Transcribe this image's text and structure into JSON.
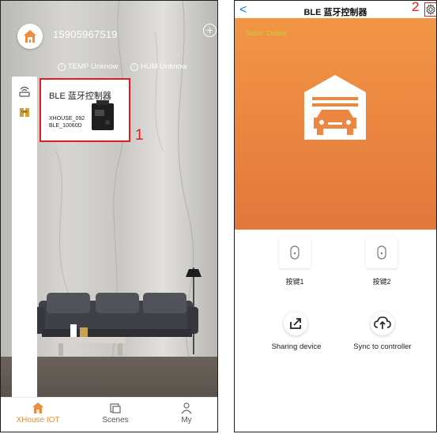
{
  "home": {
    "phone": "15905967519",
    "temp_label": "TEMP Unknow",
    "hum_label": "HUM Unknow",
    "device": {
      "name": "BLE 蓝牙控制器",
      "id_line1": "XHOUSE_092",
      "id_line2": "BLE_10060D"
    },
    "marker": "1",
    "tabs": [
      {
        "label": "XHouse IOT",
        "icon": "home-icon",
        "active": true
      },
      {
        "label": "Scenes",
        "icon": "scenes-icon",
        "active": false
      },
      {
        "label": "My",
        "icon": "user-icon",
        "active": false
      }
    ],
    "accent": "#f08c3a",
    "highlight": "#e01c1c"
  },
  "controller": {
    "title": "BLE 蓝牙控制器",
    "marker": "2",
    "status": "State: Online",
    "buttons": [
      {
        "label": "按键1"
      },
      {
        "label": "按键2"
      }
    ],
    "actions": [
      {
        "label": "Sharing device",
        "icon": "share-icon"
      },
      {
        "label": "Sync to controller",
        "icon": "cloud-sync-icon"
      }
    ],
    "hero_color": "#ec8640",
    "back_color": "#1f7dd9"
  }
}
